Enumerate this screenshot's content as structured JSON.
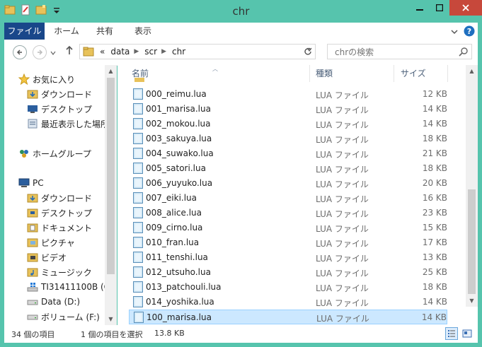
{
  "window": {
    "title": "chr"
  },
  "ribbon": {
    "tabs": [
      "ファイル",
      "ホーム",
      "共有",
      "表示"
    ]
  },
  "address": {
    "overflow": "«",
    "segments": [
      "data",
      "scr",
      "chr"
    ]
  },
  "search": {
    "placeholder": "chrの検索"
  },
  "nav": {
    "favorites": {
      "label": "お気に入り",
      "items": [
        "ダウンロード",
        "デスクトップ",
        "最近表示した場所"
      ]
    },
    "homegroup": "ホームグループ",
    "pc": {
      "label": "PC",
      "items": [
        "ダウンロード",
        "デスクトップ",
        "ドキュメント",
        "ピクチャ",
        "ビデオ",
        "ミュージック",
        "TI31411100B (C",
        "Data (D:)",
        "ボリューム (F:)"
      ]
    }
  },
  "columns": {
    "name": "名前",
    "type": "種類",
    "size": "サイズ"
  },
  "files": [
    {
      "name": "000_reimu.lua",
      "type": "LUA ファイル",
      "size": "12 KB"
    },
    {
      "name": "001_marisa.lua",
      "type": "LUA ファイル",
      "size": "14 KB"
    },
    {
      "name": "002_mokou.lua",
      "type": "LUA ファイル",
      "size": "14 KB"
    },
    {
      "name": "003_sakuya.lua",
      "type": "LUA ファイル",
      "size": "18 KB"
    },
    {
      "name": "004_suwako.lua",
      "type": "LUA ファイル",
      "size": "21 KB"
    },
    {
      "name": "005_satori.lua",
      "type": "LUA ファイル",
      "size": "18 KB"
    },
    {
      "name": "006_yuyuko.lua",
      "type": "LUA ファイル",
      "size": "20 KB"
    },
    {
      "name": "007_eiki.lua",
      "type": "LUA ファイル",
      "size": "16 KB"
    },
    {
      "name": "008_alice.lua",
      "type": "LUA ファイル",
      "size": "23 KB"
    },
    {
      "name": "009_cirno.lua",
      "type": "LUA ファイル",
      "size": "15 KB"
    },
    {
      "name": "010_fran.lua",
      "type": "LUA ファイル",
      "size": "17 KB"
    },
    {
      "name": "011_tenshi.lua",
      "type": "LUA ファイル",
      "size": "13 KB"
    },
    {
      "name": "012_utsuho.lua",
      "type": "LUA ファイル",
      "size": "25 KB"
    },
    {
      "name": "013_patchouli.lua",
      "type": "LUA ファイル",
      "size": "18 KB"
    },
    {
      "name": "014_yoshika.lua",
      "type": "LUA ファイル",
      "size": "14 KB"
    },
    {
      "name": "100_marisa.lua",
      "type": "LUA ファイル",
      "size": "14 KB",
      "selected": true
    }
  ],
  "status": {
    "count": "34 個の項目",
    "selection": "1 個の項目を選択",
    "selected_size": "13.8 KB"
  },
  "colors": {
    "frame": "#56c4ad",
    "file_tab": "#19478a",
    "close": "#c7483b",
    "selection": "#cce8ff"
  }
}
